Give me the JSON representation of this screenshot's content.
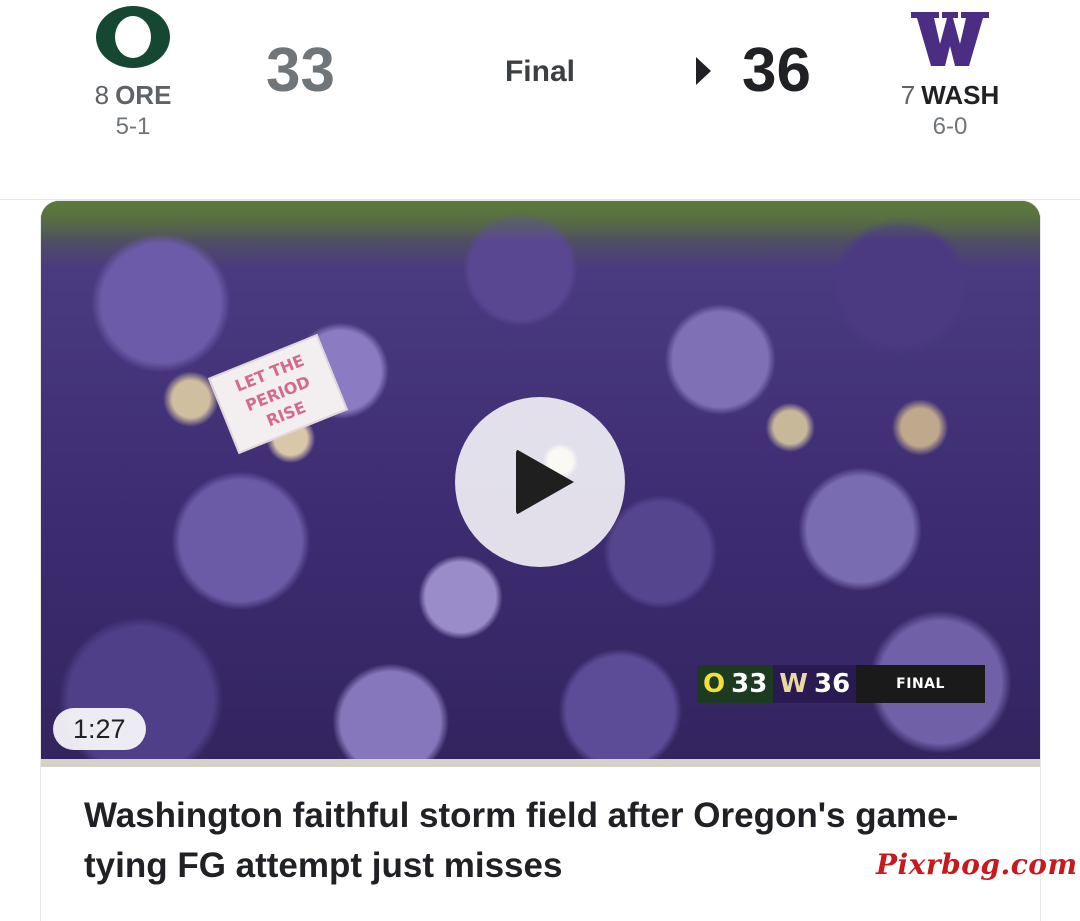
{
  "scoreboard": {
    "away": {
      "rank": "8",
      "abbr": "ORE",
      "record": "5-1",
      "score": "33",
      "logo_icon": "oregon-o-logo",
      "color": "#154733"
    },
    "status": "Final",
    "home": {
      "rank": "7",
      "abbr": "WASH",
      "record": "6-0",
      "score": "36",
      "logo_icon": "washington-w-logo",
      "color": "#4b2e83"
    },
    "winner_indicator_icon": "triangle-right-icon"
  },
  "video": {
    "duration": "1:27",
    "play_icon": "play-icon",
    "sign_text": "LET THE PERIOD RISE",
    "score_bug": {
      "away_logo": "O",
      "away_score": "33",
      "home_logo": "W",
      "home_score": "36",
      "status": "FINAL"
    }
  },
  "article": {
    "headline": "Washington faithful storm field after Oregon's game-tying FG attempt just misses"
  },
  "watermark": "Pixrbog.com"
}
